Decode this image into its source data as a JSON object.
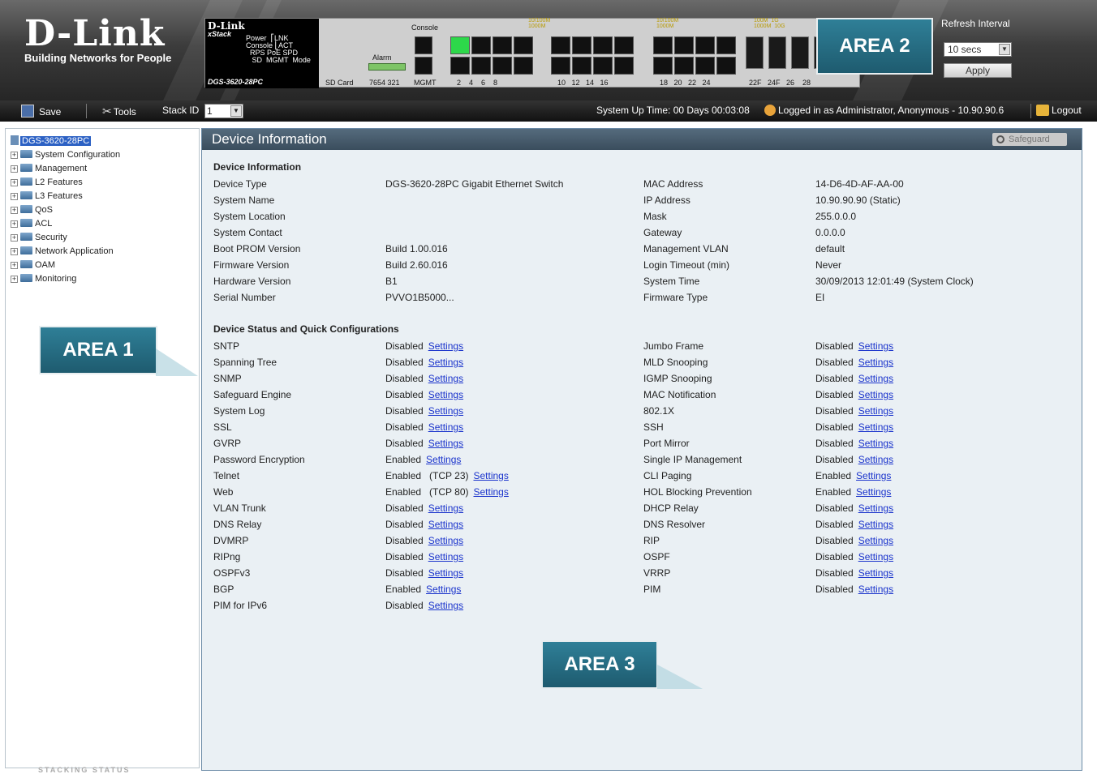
{
  "header": {
    "brand": "D-Link",
    "tagline": "Building Networks for People",
    "panel": {
      "mini_brand": "D-Link",
      "series": "xStack",
      "model": "DGS-3620-28PC",
      "leds": "Power  ⎡LNK\nConsole ⎣ACT\n  RPS PoE SPD\n   SD  MGMT  Mode",
      "console_label": "Console",
      "alarm_label": "Alarm",
      "sdcard_label": "SD Card",
      "alarm_pins": "7654  321",
      "mgmt_label": "MGMT",
      "speed_a": "10/100M\n1000M",
      "speed_b": "10/100M\n1000M",
      "speed_c": "100M  1G\n1000M  10G",
      "port_numbers_a": "2    4    6    8",
      "port_numbers_b": "10   12   14   16",
      "port_numbers_c": "18   20   22   24",
      "port_numbers_d": "22F   24F   26    28"
    },
    "area2_label": "AREA 2",
    "refresh": {
      "label": "Refresh Interval",
      "value": "10 secs",
      "apply": "Apply"
    }
  },
  "toolbar": {
    "save": "Save",
    "tools": "Tools",
    "stack_id_label": "Stack ID",
    "stack_id_value": "1",
    "uptime": "System Up Time: 00 Days 00:03:08",
    "logged_in": "Logged in as Administrator, Anonymous - 10.90.90.6",
    "logout": "Logout"
  },
  "tree": {
    "root": "DGS-3620-28PC",
    "items": [
      "System Configuration",
      "Management",
      "L2 Features",
      "L3 Features",
      "QoS",
      "ACL",
      "Security",
      "Network Application",
      "OAM",
      "Monitoring"
    ],
    "stacking_status": "STACKING STATUS"
  },
  "area1_label": "AREA 1",
  "area3_label": "AREA 3",
  "main": {
    "title": "Device Information",
    "safeguard": "Safeguard",
    "device_info_heading": "Device Information",
    "info_left": [
      {
        "k": "Device Type",
        "v": "DGS-3620-28PC Gigabit Ethernet Switch"
      },
      {
        "k": "System Name",
        "v": ""
      },
      {
        "k": "System Location",
        "v": ""
      },
      {
        "k": "System Contact",
        "v": ""
      },
      {
        "k": "Boot PROM Version",
        "v": "Build 1.00.016"
      },
      {
        "k": "Firmware Version",
        "v": "Build 2.60.016"
      },
      {
        "k": "Hardware Version",
        "v": "B1"
      },
      {
        "k": "Serial Number",
        "v": "PVVO1B5000..."
      }
    ],
    "info_right": [
      {
        "k": "MAC Address",
        "v": "14-D6-4D-AF-AA-00"
      },
      {
        "k": "IP Address",
        "v": "10.90.90.90 (Static)"
      },
      {
        "k": "Mask",
        "v": "255.0.0.0"
      },
      {
        "k": "Gateway",
        "v": "0.0.0.0"
      },
      {
        "k": "Management VLAN",
        "v": "default"
      },
      {
        "k": "Login Timeout (min)",
        "v": "Never"
      },
      {
        "k": "System Time",
        "v": "30/09/2013 12:01:49 (System Clock)"
      },
      {
        "k": "Firmware Type",
        "v": "EI"
      }
    ],
    "status_heading": "Device Status and Quick Configurations",
    "settings_label": "Settings",
    "status_left": [
      {
        "k": "SNTP",
        "v": "Disabled"
      },
      {
        "k": "Spanning Tree",
        "v": "Disabled"
      },
      {
        "k": "SNMP",
        "v": "Disabled"
      },
      {
        "k": "Safeguard Engine",
        "v": "Disabled"
      },
      {
        "k": "System Log",
        "v": "Disabled"
      },
      {
        "k": "SSL",
        "v": "Disabled"
      },
      {
        "k": "GVRP",
        "v": "Disabled"
      },
      {
        "k": "Password Encryption",
        "v": "Enabled"
      },
      {
        "k": "Telnet",
        "v": "Enabled   (TCP 23)"
      },
      {
        "k": "Web",
        "v": "Enabled   (TCP 80)"
      },
      {
        "k": "VLAN Trunk",
        "v": "Disabled"
      },
      {
        "k": "DNS Relay",
        "v": "Disabled"
      },
      {
        "k": "DVMRP",
        "v": "Disabled"
      },
      {
        "k": "RIPng",
        "v": "Disabled"
      },
      {
        "k": "OSPFv3",
        "v": "Disabled"
      },
      {
        "k": "BGP",
        "v": "Enabled"
      },
      {
        "k": "PIM for IPv6",
        "v": "Disabled"
      }
    ],
    "status_right": [
      {
        "k": "Jumbo Frame",
        "v": "Disabled"
      },
      {
        "k": "MLD Snooping",
        "v": "Disabled"
      },
      {
        "k": "IGMP Snooping",
        "v": "Disabled"
      },
      {
        "k": "MAC Notification",
        "v": "Disabled"
      },
      {
        "k": "802.1X",
        "v": "Disabled"
      },
      {
        "k": "SSH",
        "v": "Disabled"
      },
      {
        "k": "Port Mirror",
        "v": "Disabled"
      },
      {
        "k": "Single IP Management",
        "v": "Disabled"
      },
      {
        "k": "CLI Paging",
        "v": "Enabled"
      },
      {
        "k": "HOL Blocking Prevention",
        "v": "Enabled"
      },
      {
        "k": "DHCP Relay",
        "v": "Disabled"
      },
      {
        "k": "DNS Resolver",
        "v": "Disabled"
      },
      {
        "k": "RIP",
        "v": "Disabled"
      },
      {
        "k": "OSPF",
        "v": "Disabled"
      },
      {
        "k": "VRRP",
        "v": "Disabled"
      },
      {
        "k": "PIM",
        "v": "Disabled"
      }
    ]
  },
  "colors": {
    "link": "#1a33cc",
    "area_callout": "#2f7f97",
    "title_bar": "#4a5e6e",
    "tree_selected": "#2c61c4",
    "port_active": "#2dd84a"
  }
}
